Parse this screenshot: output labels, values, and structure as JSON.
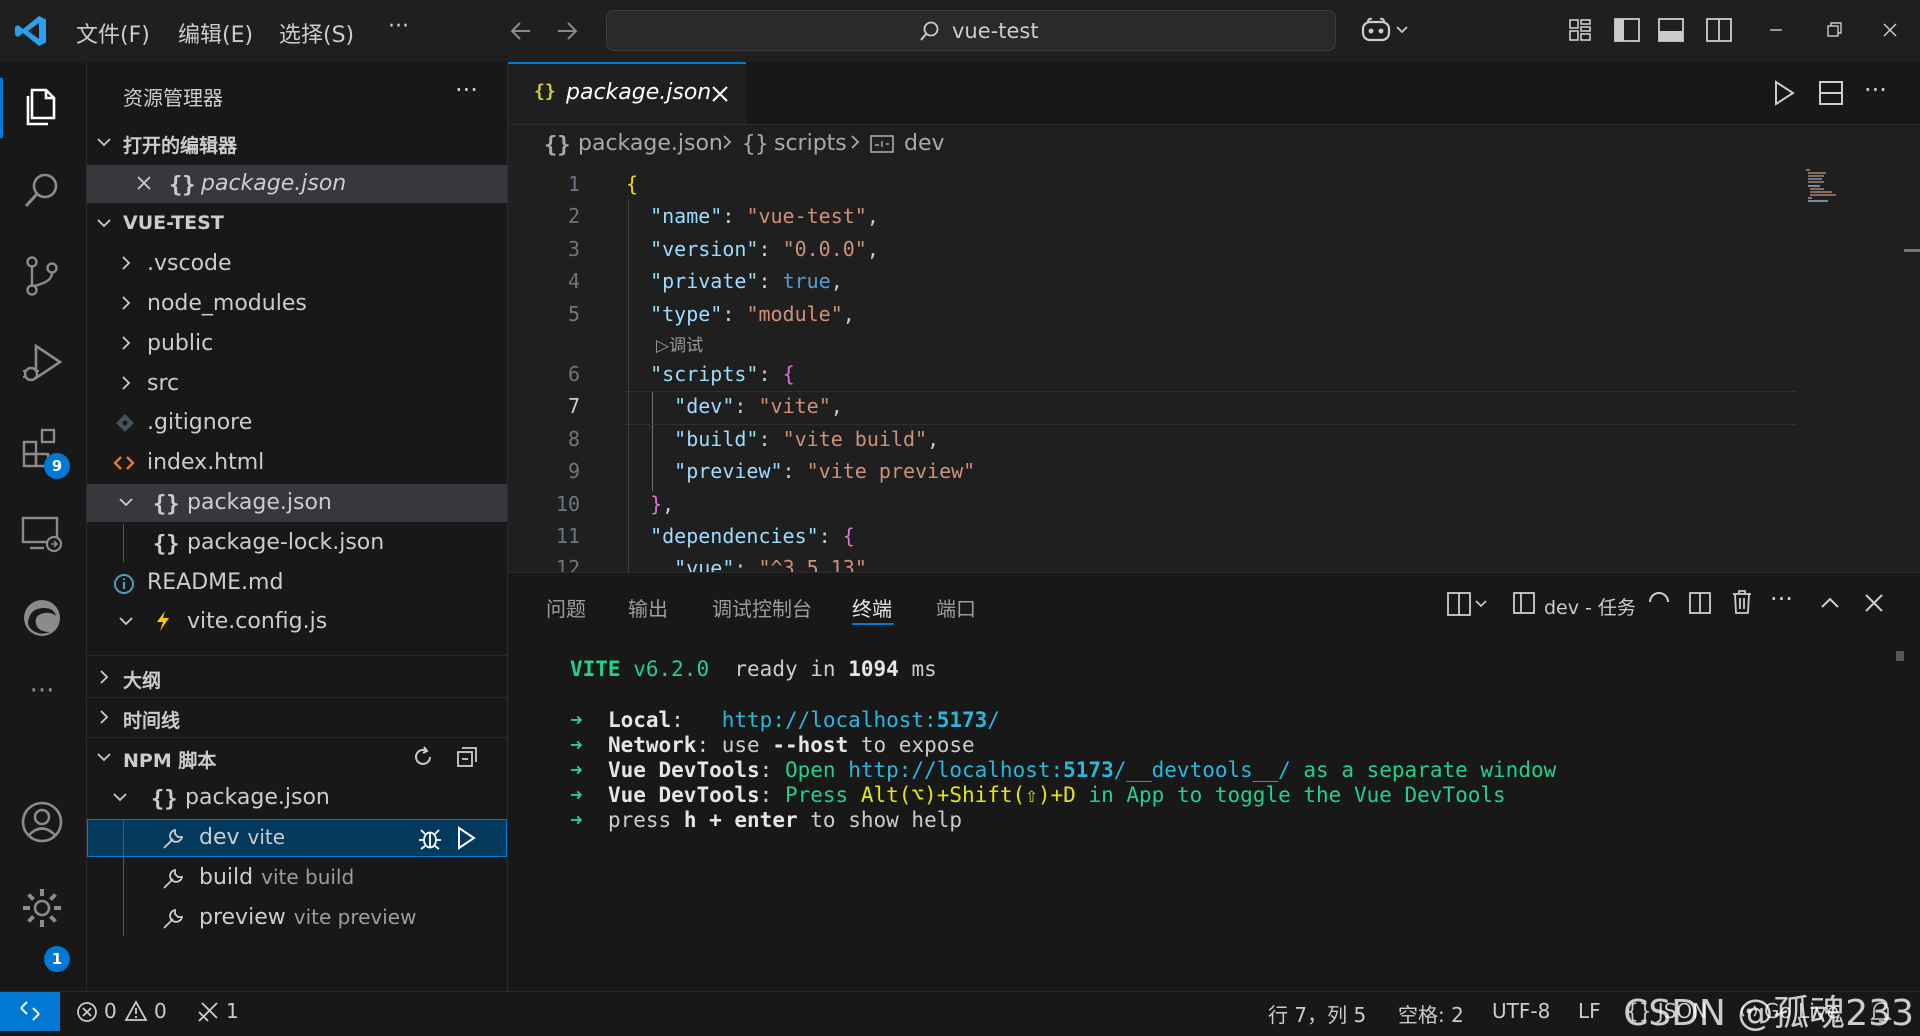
{
  "titlebar": {
    "menus": [
      "文件(F)",
      "编辑(E)",
      "选择(S)",
      "···"
    ],
    "search_text": "vue-test"
  },
  "activity": {
    "extensions_badge": "9",
    "settings_badge": "1"
  },
  "explorer": {
    "title": "资源管理器",
    "more": "···",
    "open_editors_label": "打开的编辑器",
    "open_editor_file": "package.json",
    "project_label": "VUE-TEST",
    "items": [
      ".vscode",
      "node_modules",
      "public",
      "src",
      ".gitignore",
      "index.html",
      "package.json",
      "package-lock.json",
      "README.md",
      "vite.config.js"
    ],
    "json_icon": "{}",
    "outline_label": "大纲",
    "timeline_label": "时间线",
    "npm_label": "NPM 脚本",
    "npm_file": "package.json",
    "scripts": [
      {
        "name": "dev",
        "cmd": "vite"
      },
      {
        "name": "build",
        "cmd": "vite build"
      },
      {
        "name": "preview",
        "cmd": "vite preview"
      }
    ]
  },
  "editor": {
    "tab_label": "package.json",
    "breadcrumb": [
      "package.json",
      "scripts",
      "dev"
    ],
    "codelens": "▷调试",
    "line_numbers": [
      "1",
      "2",
      "3",
      "4",
      "5",
      "6",
      "7",
      "8",
      "9",
      "10",
      "11",
      "12"
    ],
    "current_line": "7"
  },
  "panel": {
    "tabs": [
      "问题",
      "输出",
      "调试控制台",
      "终端",
      "端口"
    ],
    "terminal_name": "dev - 任务",
    "vite_label": "VITE",
    "vite_version": "v6.2.0",
    "ready_text": "ready in",
    "ready_ms": "1094",
    "ms": "ms",
    "arrow": "➜",
    "local_label": "Local",
    "local_url_prefix": "http://localhost:",
    "local_port": "5173",
    "network_label": "Network",
    "network_text": "use",
    "network_flag": "--host",
    "network_suffix": "to expose",
    "devtools_label": "Vue DevTools",
    "devtools_open": "Open",
    "devtools_url_prefix": "http://localhost:",
    "devtools_port": "5173",
    "devtools_url_suffix": "/__devtools__/",
    "devtools_window": "as a separate window",
    "devtools_press": "Press",
    "devtools_keys": "Alt(⌥)+Shift(⇧)+D",
    "devtools_toggle": "in App to toggle the Vue DevTools",
    "help_press": "press",
    "help_key": "h + enter",
    "help_suffix": "to show help"
  },
  "statusbar": {
    "errors": "0",
    "warnings": "0",
    "ports": "1",
    "position": "行 7，列 5",
    "spaces": "空格: 2",
    "encoding": "UTF-8",
    "eol": "LF",
    "language": "{} JSON",
    "golive": "Go Live"
  },
  "watermark": "CSDN @孤魂233"
}
